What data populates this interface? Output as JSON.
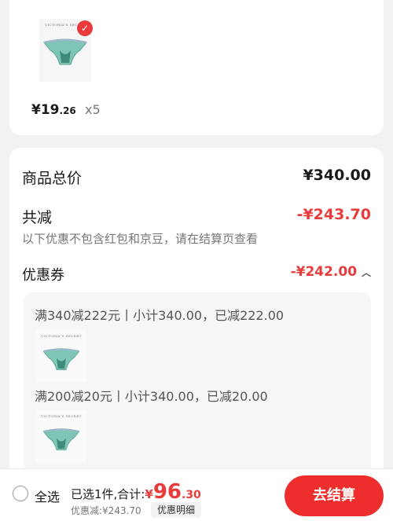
{
  "product": {
    "brand": "VICTORIA'S SECRET",
    "currency": "¥",
    "price_int": "19",
    "price_dec": ".26",
    "quantity": "x5",
    "selected": true
  },
  "summary": {
    "total_label": "商品总价",
    "total_value": "¥340.00",
    "discount_label": "共减",
    "discount_value": "-¥243.70",
    "discount_note": "以下优惠不包含红包和京豆，请在结算页查看",
    "coupon_label": "优惠券",
    "coupon_value": "-¥242.00",
    "coupons": [
      {
        "text": "满340减222元丨小计340.00，已减222.00"
      },
      {
        "text": "满200减20元丨小计340.00，已减20.00"
      }
    ]
  },
  "bottom_bar": {
    "select_all": "全选",
    "selected_text": "已选1件,合计:",
    "total_currency": "¥",
    "total_int": "96",
    "total_dec": ".30",
    "saved_text": "优惠减:¥243.70",
    "detail_button": "优惠明细",
    "checkout_button": "去结算"
  },
  "colors": {
    "accent": "#e93b3b",
    "background": "#f2f2f2"
  }
}
